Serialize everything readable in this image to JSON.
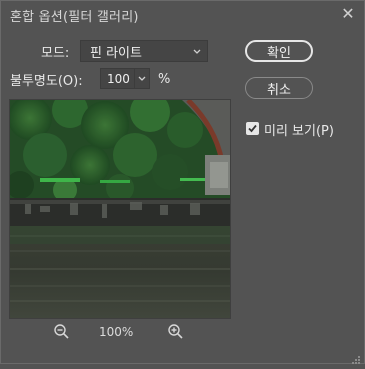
{
  "window": {
    "title": "혼합 옵션(필터 갤러리)",
    "close_glyph": "✕"
  },
  "mode": {
    "label": "모드:",
    "value": "핀 라이트"
  },
  "opacity": {
    "label": "불투명도(O):",
    "value": "100",
    "unit": "%"
  },
  "buttons": {
    "ok": "확인",
    "cancel": "취소"
  },
  "preview_checkbox": {
    "label": "미리 보기(P)",
    "checked": true
  },
  "zoom": {
    "level": "100%"
  },
  "icons": {
    "close": "close-icon",
    "chevron": "chevron-down-icon",
    "checkmark": "checkmark-icon",
    "zoom_out": "zoom-out-icon",
    "zoom_in": "zoom-in-icon"
  }
}
